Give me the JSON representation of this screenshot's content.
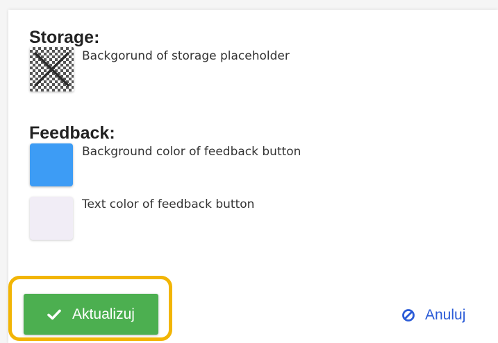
{
  "storage": {
    "title": "Storage:",
    "items": [
      {
        "label": "Backgorund of storage placeholder",
        "swatch_type": "transparent-checker",
        "icon": "x-mark-icon"
      }
    ]
  },
  "feedback": {
    "title": "Feedback:",
    "items": [
      {
        "label": "Background color of feedback button",
        "color": "#3d9cf5"
      },
      {
        "label": "Text color of feedback button",
        "color": "#f1edf6"
      }
    ]
  },
  "actions": {
    "update_label": "Aktualizuj",
    "update_icon": "checkmark-icon",
    "update_color": "#4caf50",
    "cancel_label": "Anuluj",
    "cancel_icon": "ban-icon",
    "cancel_color": "#2a5bd7",
    "highlight_color": "#f2b505"
  }
}
